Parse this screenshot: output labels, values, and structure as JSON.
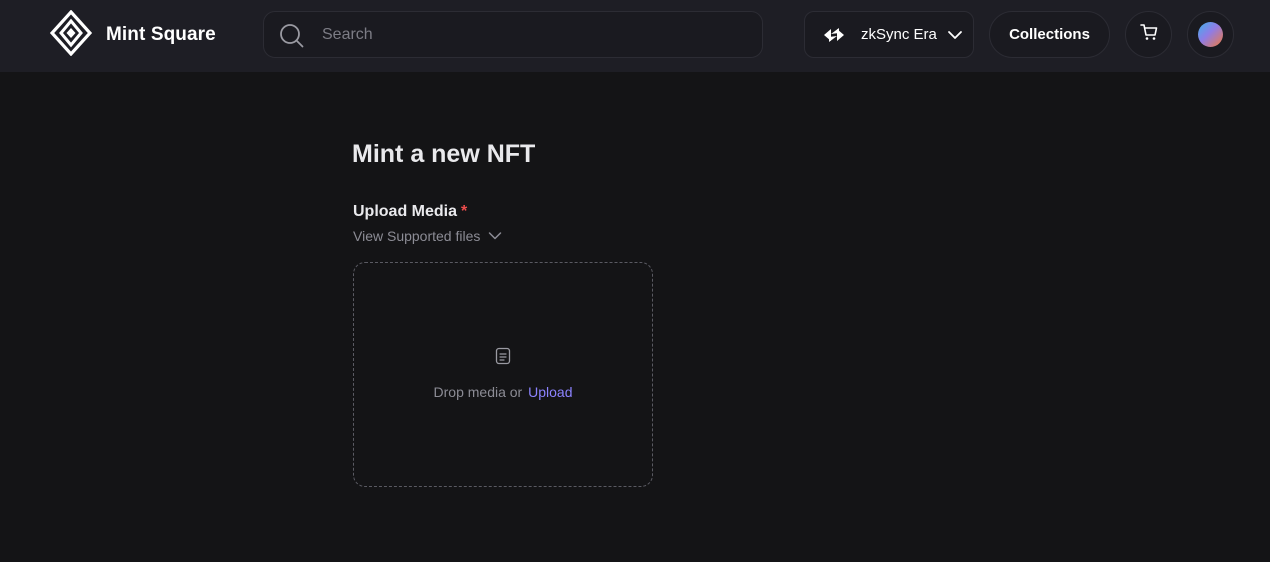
{
  "header": {
    "brand_name": "Mint Square",
    "search_placeholder": "Search",
    "network_label": "zkSync Era",
    "collections_label": "Collections",
    "icons": {
      "logo": "mint-square-logo",
      "search": "search-icon",
      "network": "network-arrows-icon",
      "chevron": "chevron-down-icon",
      "cart": "cart-icon",
      "avatar": "avatar"
    }
  },
  "main": {
    "title": "Mint a new NFT",
    "upload_label": "Upload Media",
    "required_mark": "*",
    "supported_files_label": "View Supported files",
    "drop_text": "Drop media or",
    "upload_link": "Upload",
    "icons": {
      "file": "file-icon",
      "chevron": "chevron-down-icon"
    }
  },
  "colors": {
    "background": "#141416",
    "header_background": "#1e1e25",
    "accent_link": "#8c83ff",
    "required": "#ef4d4d"
  }
}
